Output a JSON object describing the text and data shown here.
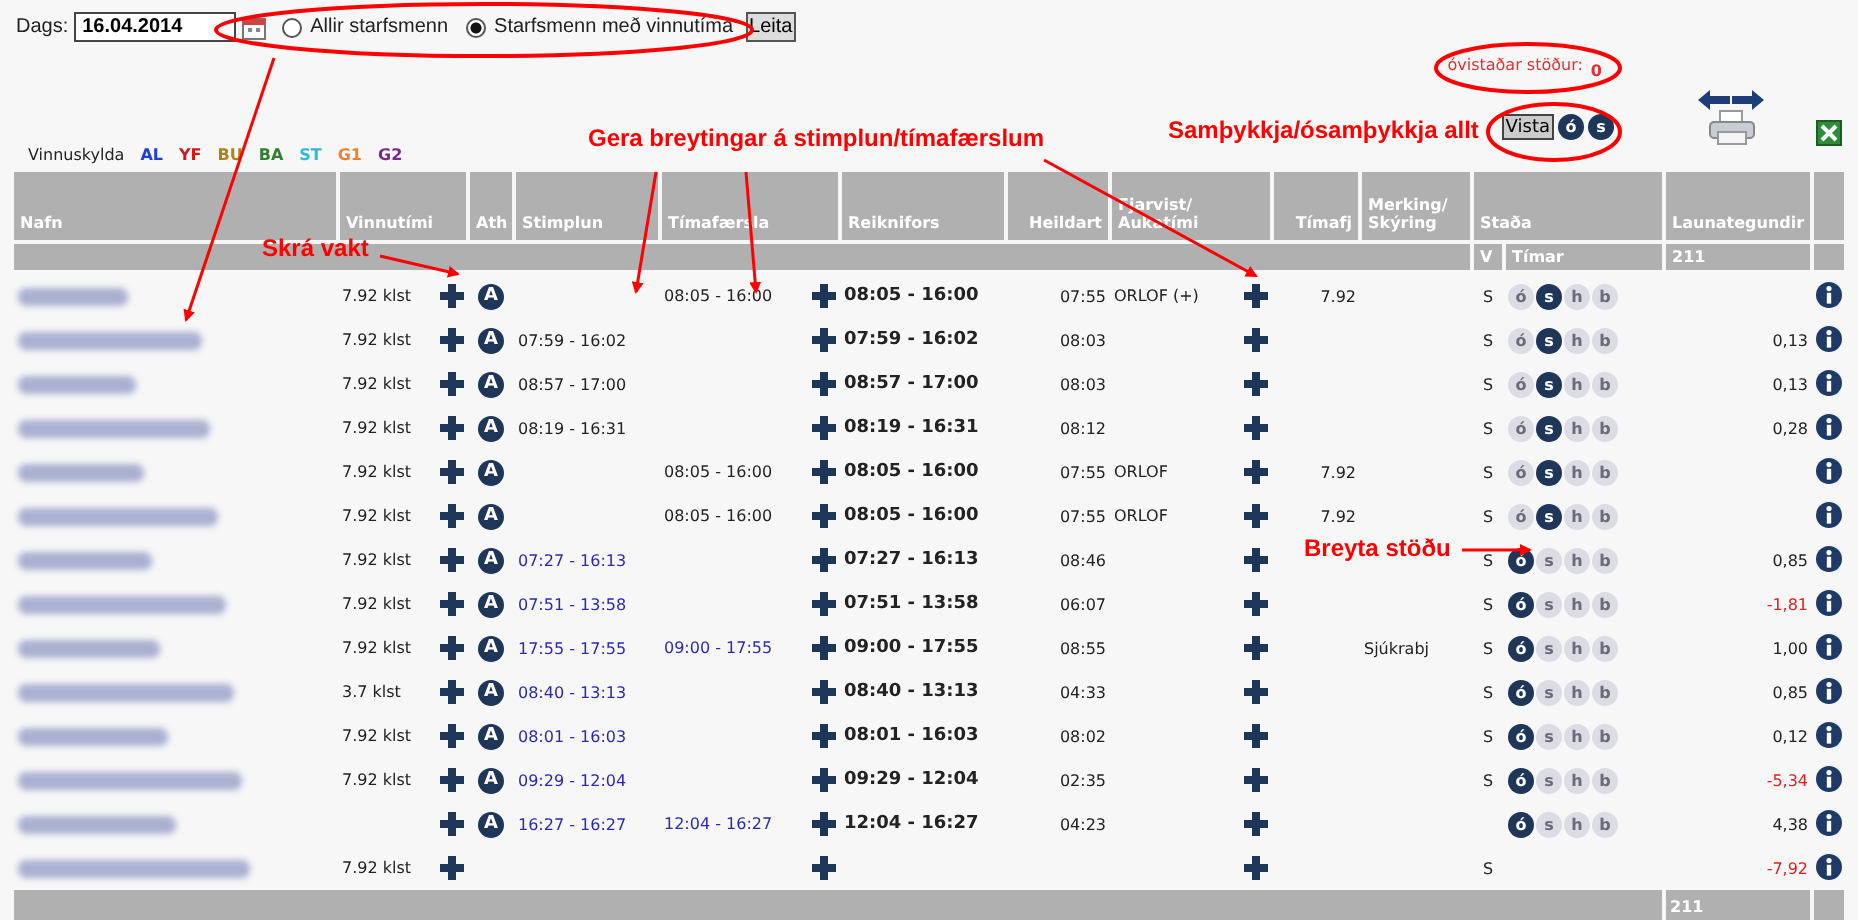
{
  "date_label": "Dags:",
  "date_value": "16.04.2014",
  "radios": [
    {
      "label": "Allir starfsmenn",
      "selected": false
    },
    {
      "label": "Starfsmenn með vinnutíma",
      "selected": true
    }
  ],
  "search_button": "Leita",
  "unsaved_label": "óvistaðar stöður:",
  "unsaved_count": "0",
  "save_button": "Vista",
  "bulk_status": [
    {
      "label": "ó"
    },
    {
      "label": "s"
    }
  ],
  "legend_label": "Vinnuskylda",
  "legend": [
    {
      "code": "AL",
      "color": "#1f3fd0"
    },
    {
      "code": "YF",
      "color": "#d01818"
    },
    {
      "code": "BU",
      "color": "#a8841a"
    },
    {
      "code": "BA",
      "color": "#2f7f2f"
    },
    {
      "code": "ST",
      "color": "#30b8d8"
    },
    {
      "code": "G1",
      "color": "#f08030"
    },
    {
      "code": "G2",
      "color": "#7a2a8a"
    }
  ],
  "columns": [
    "Nafn",
    "Vinnutími",
    "Ath",
    "Stimplun",
    "Tímafærsla",
    "Reiknifors",
    "Heildart",
    "Fjarvist/\nAukatími",
    "Tímafj",
    "Merking/\nSkýring",
    "Staða",
    "Launategundir"
  ],
  "subheader": {
    "v": "V",
    "timar": "Tímar",
    "launategundir": "211"
  },
  "rows": [
    {
      "vinnutimi": "7.92 klst",
      "ath": "A",
      "timafaersla": "08:05 - 16:00",
      "timafaersla_highlighted": false,
      "reiknifors": "08:05 - 16:00",
      "heildart": "07:55",
      "fjarvist": "ORLOF (+)",
      "timafj": "7.92",
      "v": "S",
      "status": [
        {
          "label": "ó",
          "selected": false
        },
        {
          "label": "s",
          "selected": true
        },
        {
          "label": "h",
          "selected": false
        },
        {
          "label": "b",
          "selected": false
        }
      ]
    },
    {
      "vinnutimi": "7.92 klst",
      "ath": "A",
      "stimplun": "07:59 - 16:02",
      "stimplun_highlighted": false,
      "reiknifors": "07:59 - 16:02",
      "heildart": "08:03",
      "v": "S",
      "status": [
        {
          "label": "ó",
          "selected": false
        },
        {
          "label": "s",
          "selected": true
        },
        {
          "label": "h",
          "selected": false
        },
        {
          "label": "b",
          "selected": false
        }
      ],
      "launategundir": "0,13",
      "negative": false
    },
    {
      "vinnutimi": "7.92 klst",
      "ath": "A",
      "stimplun": "08:57 - 17:00",
      "stimplun_highlighted": false,
      "reiknifors": "08:57 - 17:00",
      "heildart": "08:03",
      "v": "S",
      "status": [
        {
          "label": "ó",
          "selected": false
        },
        {
          "label": "s",
          "selected": true
        },
        {
          "label": "h",
          "selected": false
        },
        {
          "label": "b",
          "selected": false
        }
      ],
      "launategundir": "0,13",
      "negative": false
    },
    {
      "vinnutimi": "7.92 klst",
      "ath": "A",
      "stimplun": "08:19 - 16:31",
      "stimplun_highlighted": false,
      "reiknifors": "08:19 - 16:31",
      "heildart": "08:12",
      "v": "S",
      "status": [
        {
          "label": "ó",
          "selected": false
        },
        {
          "label": "s",
          "selected": true
        },
        {
          "label": "h",
          "selected": false
        },
        {
          "label": "b",
          "selected": false
        }
      ],
      "launategundir": "0,28",
      "negative": false
    },
    {
      "vinnutimi": "7.92 klst",
      "ath": "A",
      "timafaersla": "08:05 - 16:00",
      "timafaersla_highlighted": false,
      "reiknifors": "08:05 - 16:00",
      "heildart": "07:55",
      "fjarvist": "ORLOF",
      "timafj": "7.92",
      "v": "S",
      "status": [
        {
          "label": "ó",
          "selected": false
        },
        {
          "label": "s",
          "selected": true
        },
        {
          "label": "h",
          "selected": false
        },
        {
          "label": "b",
          "selected": false
        }
      ]
    },
    {
      "vinnutimi": "7.92 klst",
      "ath": "A",
      "timafaersla": "08:05 - 16:00",
      "timafaersla_highlighted": false,
      "reiknifors": "08:05 - 16:00",
      "heildart": "07:55",
      "fjarvist": "ORLOF",
      "timafj": "7.92",
      "v": "S",
      "status": [
        {
          "label": "ó",
          "selected": false
        },
        {
          "label": "s",
          "selected": true
        },
        {
          "label": "h",
          "selected": false
        },
        {
          "label": "b",
          "selected": false
        }
      ]
    },
    {
      "vinnutimi": "7.92 klst",
      "ath": "A",
      "stimplun": "07:27 - 16:13",
      "stimplun_highlighted": true,
      "reiknifors": "07:27 - 16:13",
      "heildart": "08:46",
      "v": "S",
      "status": [
        {
          "label": "ó",
          "selected": true
        },
        {
          "label": "s",
          "selected": false
        },
        {
          "label": "h",
          "selected": false
        },
        {
          "label": "b",
          "selected": false
        }
      ],
      "launategundir": "0,85",
      "negative": false
    },
    {
      "vinnutimi": "7.92 klst",
      "ath": "A",
      "stimplun": "07:51 - 13:58",
      "stimplun_highlighted": true,
      "reiknifors": "07:51 - 13:58",
      "heildart": "06:07",
      "v": "S",
      "status": [
        {
          "label": "ó",
          "selected": true
        },
        {
          "label": "s",
          "selected": false
        },
        {
          "label": "h",
          "selected": false
        },
        {
          "label": "b",
          "selected": false
        }
      ],
      "launategundir": "-1,81",
      "negative": true
    },
    {
      "vinnutimi": "7.92 klst",
      "ath": "A",
      "stimplun": "17:55 - 17:55",
      "stimplun_highlighted": true,
      "timafaersla": "09:00 - 17:55",
      "timafaersla_highlighted": true,
      "reiknifors": "09:00 - 17:55",
      "heildart": "08:55",
      "merking": "Sjúkrabj",
      "v": "S",
      "status": [
        {
          "label": "ó",
          "selected": true
        },
        {
          "label": "s",
          "selected": false
        },
        {
          "label": "h",
          "selected": false
        },
        {
          "label": "b",
          "selected": false
        }
      ],
      "launategundir": "1,00",
      "negative": false
    },
    {
      "vinnutimi": "3.7 klst",
      "ath": "A",
      "stimplun": "08:40 - 13:13",
      "stimplun_highlighted": true,
      "reiknifors": "08:40 - 13:13",
      "heildart": "04:33",
      "v": "S",
      "status": [
        {
          "label": "ó",
          "selected": true
        },
        {
          "label": "s",
          "selected": false
        },
        {
          "label": "h",
          "selected": false
        },
        {
          "label": "b",
          "selected": false
        }
      ],
      "launategundir": "0,85",
      "negative": false
    },
    {
      "vinnutimi": "7.92 klst",
      "ath": "A",
      "stimplun": "08:01 - 16:03",
      "stimplun_highlighted": true,
      "reiknifors": "08:01 - 16:03",
      "heildart": "08:02",
      "v": "S",
      "status": [
        {
          "label": "ó",
          "selected": true
        },
        {
          "label": "s",
          "selected": false
        },
        {
          "label": "h",
          "selected": false
        },
        {
          "label": "b",
          "selected": false
        }
      ],
      "launategundir": "0,12",
      "negative": false
    },
    {
      "vinnutimi": "7.92 klst",
      "ath": "A",
      "stimplun": "09:29 - 12:04",
      "stimplun_highlighted": true,
      "reiknifors": "09:29 - 12:04",
      "heildart": "02:35",
      "v": "S",
      "status": [
        {
          "label": "ó",
          "selected": true
        },
        {
          "label": "s",
          "selected": false
        },
        {
          "label": "h",
          "selected": false
        },
        {
          "label": "b",
          "selected": false
        }
      ],
      "launategundir": "-5,34",
      "negative": true
    },
    {
      "ath": "A",
      "stimplun": "16:27 - 16:27",
      "stimplun_highlighted": true,
      "timafaersla": "12:04 - 16:27",
      "timafaersla_highlighted": true,
      "reiknifors": "12:04 - 16:27",
      "heildart": "04:23",
      "status": [
        {
          "label": "ó",
          "selected": true
        },
        {
          "label": "s",
          "selected": false
        },
        {
          "label": "h",
          "selected": false
        },
        {
          "label": "b",
          "selected": false
        }
      ],
      "launategundir": "4,38",
      "negative": false
    },
    {
      "vinnutimi": "7.92 klst",
      "v": "S",
      "launategundir": "-7,92",
      "negative": true
    }
  ],
  "footer": {
    "launategundir": "211"
  },
  "annotations": [
    {
      "text": "Skrá vakt"
    },
    {
      "text": "Gera breytingar á stimplun/tímafærslum"
    },
    {
      "text": "Samþykkja/ósamþykkja allt"
    },
    {
      "text": "Breyta stöðu"
    }
  ]
}
